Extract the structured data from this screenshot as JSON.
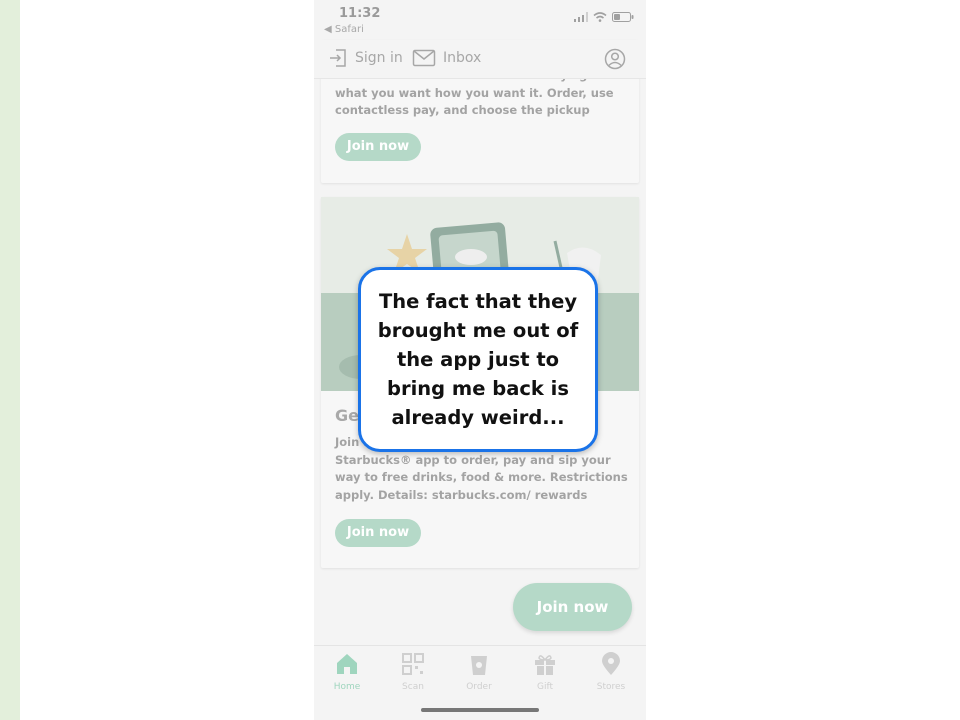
{
  "status_bar": {
    "time": "11:32",
    "back_app": "◀ Safari"
  },
  "top_nav": {
    "sign_in": "Sign in",
    "inbox": "Inbox",
    "icons": [
      "sign-in-icon",
      "inbox-icon",
      "account-icon"
    ]
  },
  "card1": {
    "body": "Your favorites are a few clicks away—get what you want how you want it. Order, use contactless pay, and choose the pickup method that's best for you.",
    "button": "Join now"
  },
  "card2": {
    "heading": "Ge",
    "body": "Join Starbucks® Rewards and use the Starbucks® app to order, pay and sip your way to free drinks, food & more. Restrictions apply. Details: starbucks.com/ rewards",
    "button": "Join now"
  },
  "floating_button": "Join now",
  "tabs": [
    {
      "label": "Home",
      "icon": "home-icon",
      "active": true
    },
    {
      "label": "Scan",
      "icon": "qr-icon",
      "active": false
    },
    {
      "label": "Order",
      "icon": "cup-icon",
      "active": false
    },
    {
      "label": "Gift",
      "icon": "gift-icon",
      "active": false
    },
    {
      "label": "Stores",
      "icon": "location-pin-icon",
      "active": false
    }
  ],
  "annotation": {
    "text": "The fact that they brought me out of the app just to bring me back is already weird..."
  },
  "colors": {
    "accent_green": "#b5d9c8",
    "bubble_border": "#1a73e8",
    "page_stripe": "#e3efdb"
  }
}
